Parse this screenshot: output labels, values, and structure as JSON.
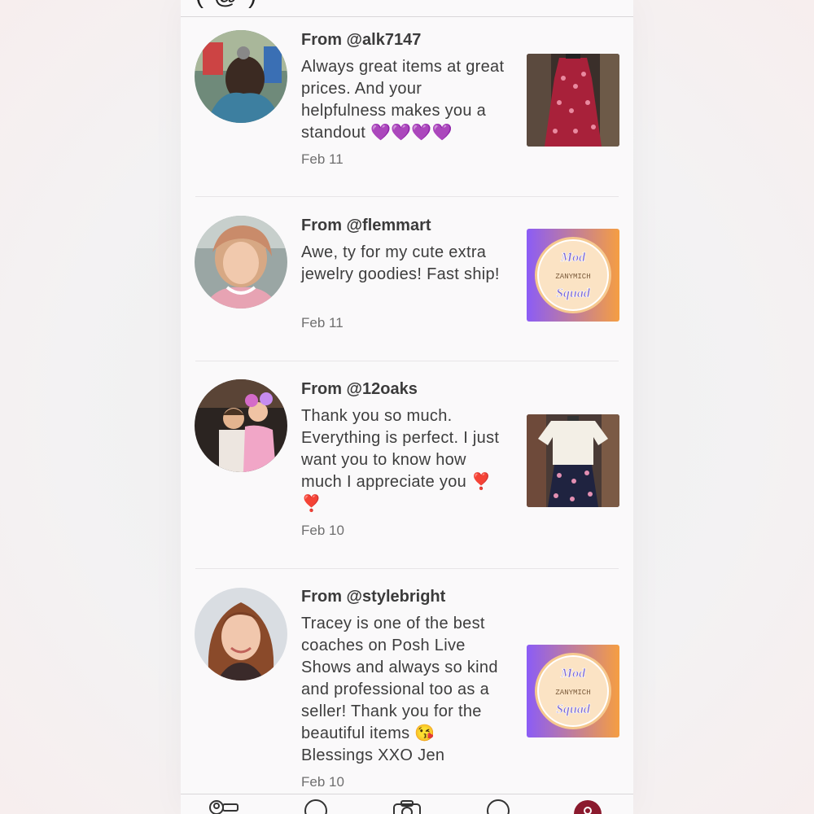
{
  "header": {
    "partial_title": "( @ )"
  },
  "reviews": [
    {
      "from": "From @alk7147",
      "message": "Always great items at great prices. And your helpfulness makes you a standout 💜💜💜💜",
      "date": "Feb 11",
      "thumb_icon": "red-floral-dress-photo"
    },
    {
      "from": "From @flemmart",
      "message": "Awe, ty for my cute extra jewelry goodies! Fast ship!",
      "date": "Feb 11",
      "thumb_icon": "mod-squad-logo"
    },
    {
      "from": "From @12oaks",
      "message": "Thank you so much. Everything is perfect. I just want you to know how much I appreciate you ❣️ ❣️",
      "date": "Feb 10",
      "thumb_icon": "white-top-floral-skirt-photo"
    },
    {
      "from": "From @stylebright",
      "message": "Tracey is one of the best coaches on Posh Live Shows and always so kind and professional too as a seller! Thank you for the beautiful items 😘 Blessings XXO Jen",
      "date": "Feb 10",
      "thumb_icon": "mod-squad-logo"
    }
  ],
  "logo": {
    "top": "Mod",
    "middle": "ZANYMICH",
    "bottom": "Squad"
  },
  "bottom_nav": [
    "feed-icon",
    "search-icon",
    "camera-icon",
    "news-icon",
    "profile-icon"
  ],
  "colors": {
    "accent": "#8b1a2e",
    "text": "#3d3d3d",
    "muted": "#6f6f6f",
    "logo_start": "#8b5cf6",
    "logo_end": "#f59e42"
  }
}
